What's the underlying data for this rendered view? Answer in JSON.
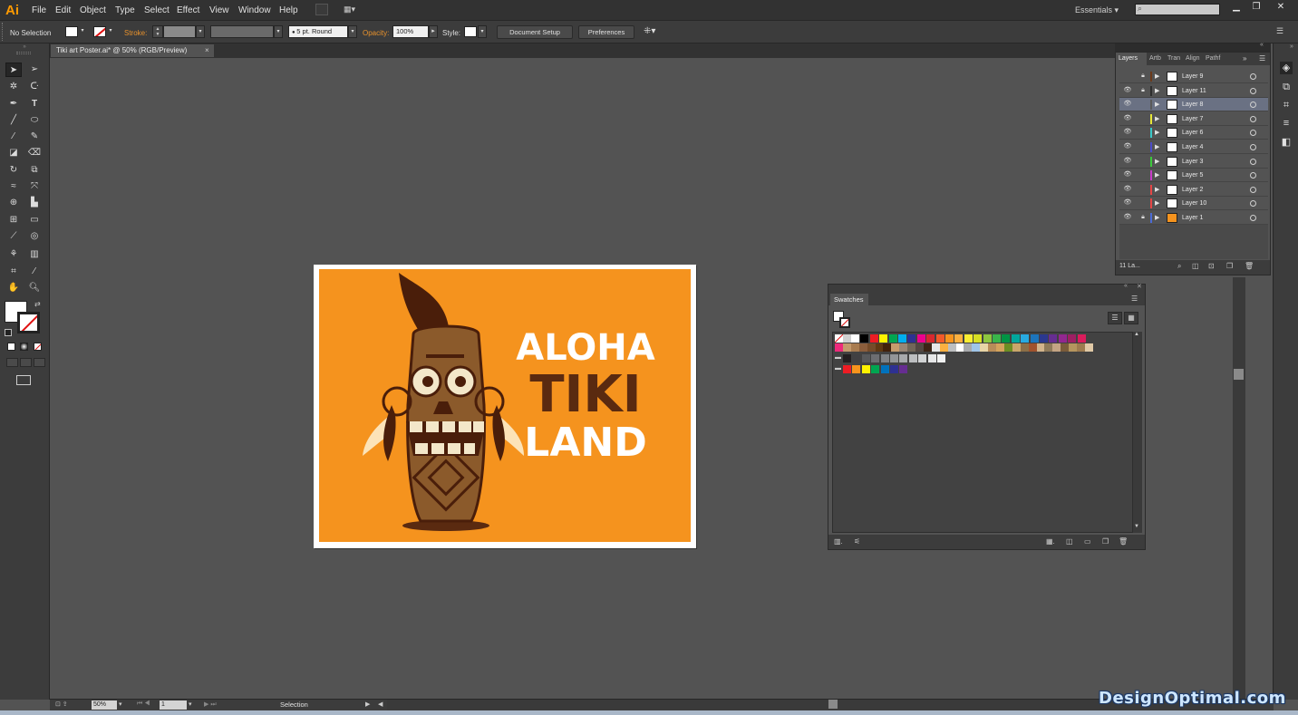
{
  "app": {
    "logo": "Ai",
    "menu": [
      "File",
      "Edit",
      "Object",
      "Type",
      "Select",
      "Effect",
      "View",
      "Window",
      "Help"
    ],
    "workspace": "Essentials",
    "search_value": ""
  },
  "control_bar": {
    "selection": "No Selection",
    "stroke_label": "Stroke:",
    "brush": "5 pt. Round",
    "opacity_label": "Opacity:",
    "opacity_value": "100%",
    "style_label": "Style:",
    "document_setup": "Document Setup",
    "preferences": "Preferences"
  },
  "document": {
    "tab_title": "Tiki art Poster.ai* @ 50% (RGB/Preview)",
    "close": "×"
  },
  "poster": {
    "line1": "ALOHA",
    "line2": "TIKI",
    "line3": "LAND",
    "bg_color": "#f5931e",
    "text_light": "#ffffff",
    "text_dark": "#5a2a10"
  },
  "layers_panel": {
    "tabs": [
      "Layers",
      "Artb",
      "Tran",
      "Align",
      "Pathf"
    ],
    "active_tab": "Layers",
    "layers": [
      {
        "name": "Layer 9",
        "color": "#6b3a1b",
        "visible": false,
        "locked": true,
        "selected": false
      },
      {
        "name": "Layer 11",
        "color": "#2d2d2d",
        "visible": true,
        "locked": true,
        "selected": false
      },
      {
        "name": "Layer 8",
        "color": "#5a5a5a",
        "visible": true,
        "locked": false,
        "selected": true
      },
      {
        "name": "Layer 7",
        "color": "#e6e637",
        "visible": true,
        "locked": false,
        "selected": false
      },
      {
        "name": "Layer 6",
        "color": "#3ac7c7",
        "visible": true,
        "locked": false,
        "selected": false
      },
      {
        "name": "Layer 4",
        "color": "#4b4bc8",
        "visible": true,
        "locked": false,
        "selected": false
      },
      {
        "name": "Layer 3",
        "color": "#3cc83c",
        "visible": true,
        "locked": false,
        "selected": false
      },
      {
        "name": "Layer 5",
        "color": "#c83cc8",
        "visible": true,
        "locked": false,
        "selected": false
      },
      {
        "name": "Layer 2",
        "color": "#e64646",
        "visible": true,
        "locked": false,
        "selected": false
      },
      {
        "name": "Layer 10",
        "color": "#e64646",
        "visible": true,
        "locked": false,
        "selected": false
      },
      {
        "name": "Layer 1",
        "color": "#4b6bd6",
        "visible": true,
        "locked": true,
        "selected": false
      }
    ],
    "footer_count": "11 La..."
  },
  "swatches_panel": {
    "title": "Swatches",
    "row1": [
      "#ffffff",
      "#000000",
      "#ed1c24",
      "#fff200",
      "#00a651",
      "#00aeef",
      "#2e3192",
      "#ec008c",
      "#d7282f",
      "#f15a29",
      "#f7941d",
      "#fbb040",
      "#f9ed32",
      "#d7df23",
      "#8dc63f",
      "#39b54a",
      "#009444",
      "#00a79d",
      "#27aae1",
      "#1c75bc",
      "#2b388f",
      "#662d91",
      "#92278f",
      "#9e1f63",
      "#da1c5c"
    ],
    "row2": [
      "#ee2a7b",
      "#c49a6c",
      "#a97c50",
      "#8b5e3c",
      "#754c29",
      "#603913",
      "#42210b",
      "#c69c6d",
      "#998675",
      "#726658",
      "#534741",
      "#3c2415",
      "#e6e7e8",
      "#fbb040",
      "#bcbec0",
      "#ffffff",
      "#a7a9ac",
      "#9fc5e8",
      "#e8d5a7",
      "#b88c58",
      "#d4a35c",
      "#6b8e23",
      "#c9a66b",
      "#8b6f47",
      "#a0522d",
      "#d2b48c",
      "#8f7a5a",
      "#c4a484",
      "#7a5c3a",
      "#b5955e",
      "#9e7b4f",
      "#e0c9a6"
    ],
    "row3": [
      "#231f20",
      "#414042",
      "#58595b",
      "#6d6e71",
      "#808285",
      "#939598",
      "#a7a9ac",
      "#bcbec0",
      "#d1d3d4",
      "#e6e7e8",
      "#f1f2f2"
    ],
    "row4": [
      "#ed1c24",
      "#f7941d",
      "#fff200",
      "#00a651",
      "#0072bc",
      "#2e3192",
      "#662d91"
    ]
  },
  "status_bar": {
    "zoom": "50%",
    "page": "1",
    "tool": "Selection"
  },
  "watermark": "DesignOptimal.com"
}
